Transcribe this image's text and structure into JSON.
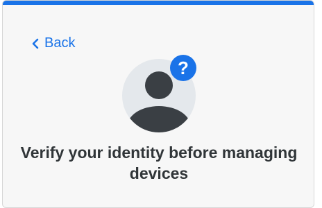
{
  "colors": {
    "accent": "#1a73e8",
    "card_background": "#f7f7f7",
    "avatar_background": "#e4e8ec",
    "avatar_figure": "#3a3f44",
    "title_text": "#303538"
  },
  "nav": {
    "back_label": "Back",
    "back_icon": "chevron-left-icon"
  },
  "avatar": {
    "icon": "person-icon",
    "badge_icon": "question-mark-icon",
    "badge_text": "?"
  },
  "main": {
    "title": "Verify your identity before managing devices"
  }
}
